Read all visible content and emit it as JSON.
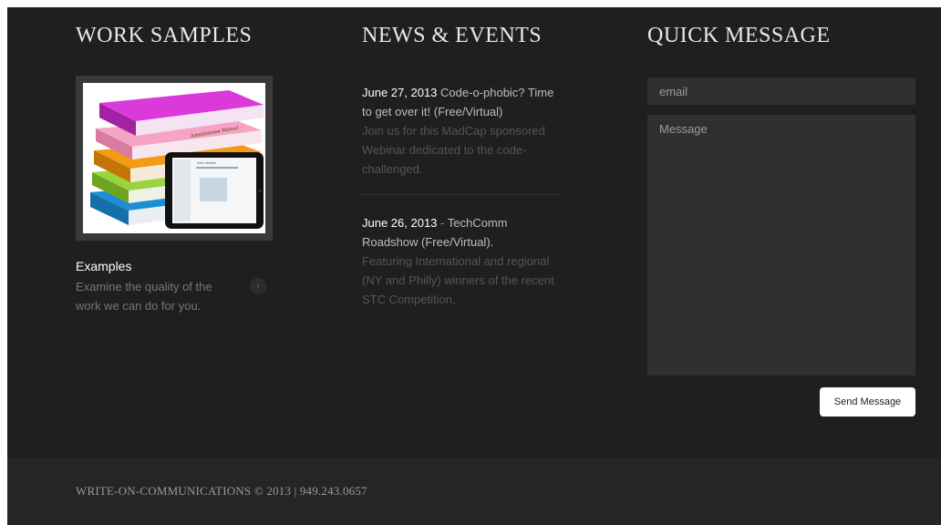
{
  "work_samples": {
    "heading": "WORK SAMPLES",
    "item_title": "Examples",
    "item_description": "Examine the quality of the work we can do for you.",
    "arrow_glyph": "›",
    "thumbnail_text": {
      "book_spine": "Administrator Manual",
      "tablet_screen": "Infor Mobile"
    }
  },
  "news": {
    "heading": "NEWS & EVENTS",
    "items": [
      {
        "date": "June 27, 2013",
        "separator": "",
        "title": "Code-o-phobic? Time to get over it! (Free/Virtual)",
        "body": "Join us for this MadCap sponsored Webinar dedicated to the code-challenged."
      },
      {
        "date": "June 26, 2013",
        "separator": "-",
        "title": "TechComm Roadshow (Free/Virtual).",
        "body": "Featuring International and regional (NY and Philly) winners of the recent STC Competition."
      }
    ]
  },
  "quick_message": {
    "heading": "QUICK MESSAGE",
    "email_placeholder": "email",
    "message_placeholder": "Message",
    "send_label": "Send Message"
  },
  "footer": {
    "text": "WRITE-ON-COMMUNICATIONS © 2013 | 949.243.0657"
  },
  "colors": {
    "background": "#1f1f1f",
    "footer_background": "#252525",
    "heading": "#e8e8e8",
    "muted_text": "#555555"
  }
}
